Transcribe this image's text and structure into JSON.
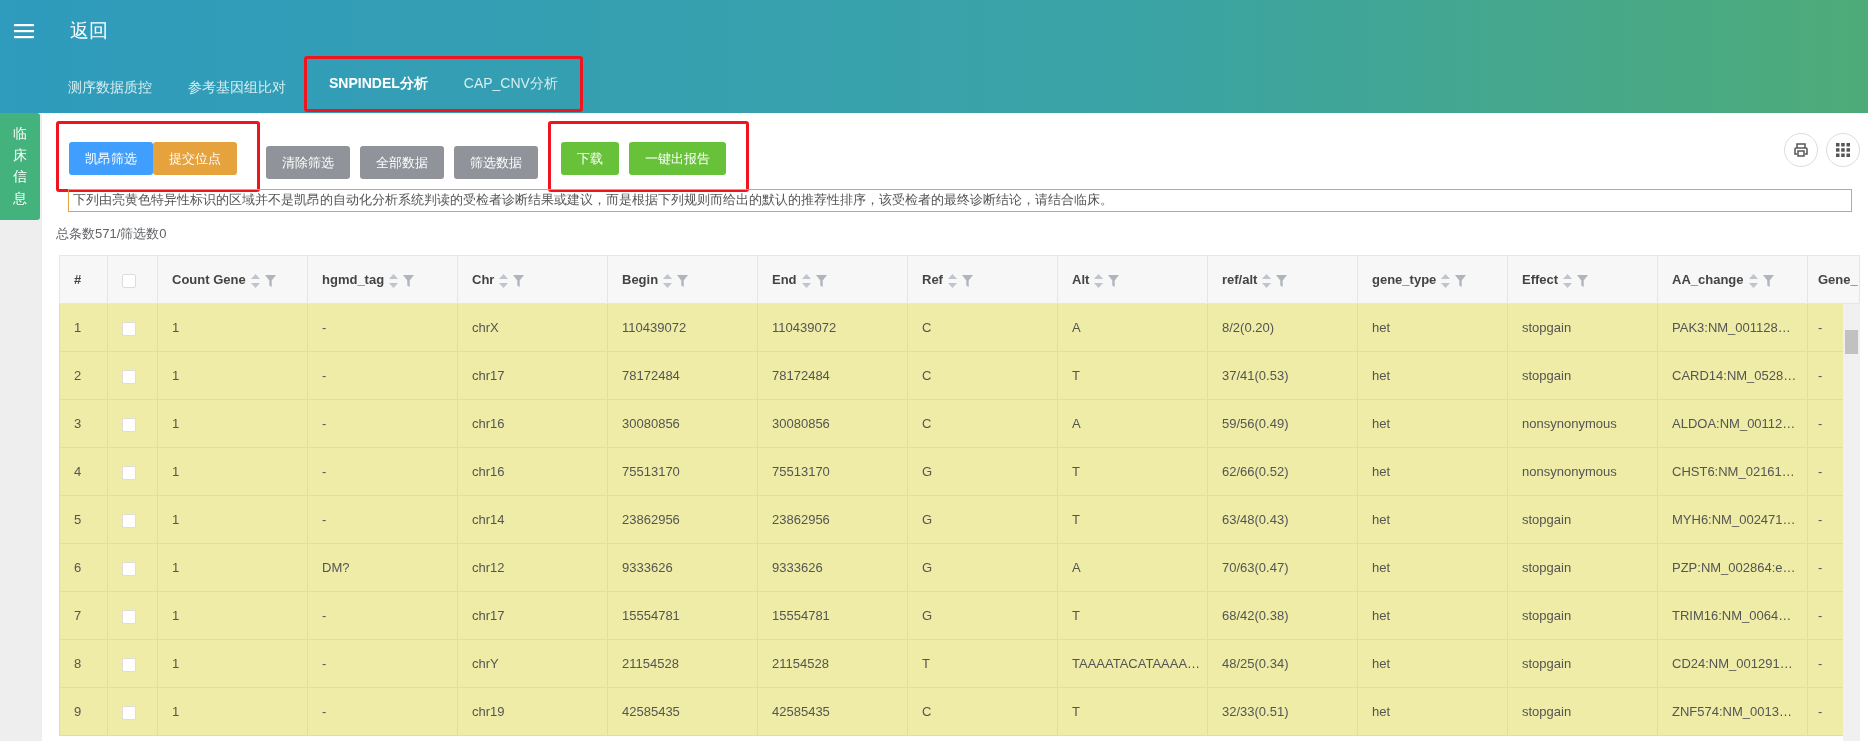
{
  "header": {
    "back": "返回"
  },
  "tabs": [
    {
      "label": "测序数据质控",
      "selected": false,
      "boxed": false
    },
    {
      "label": "参考基因组比对",
      "selected": false,
      "boxed": false
    },
    {
      "label": "SNPINDEL分析",
      "selected": true,
      "boxed": true
    },
    {
      "label": "CAP_CNV分析",
      "selected": false,
      "boxed": true
    }
  ],
  "side_tab": "临床信息",
  "buttons": [
    {
      "label": "凯昂筛选",
      "kind": "primary",
      "boxed": true
    },
    {
      "label": "提交位点",
      "kind": "warning",
      "boxed": true
    },
    {
      "label": "清除筛选",
      "kind": "info",
      "boxed": false
    },
    {
      "label": "全部数据",
      "kind": "info",
      "boxed": false
    },
    {
      "label": "筛选数据",
      "kind": "info",
      "boxed": false
    },
    {
      "label": "下载",
      "kind": "success",
      "boxed": true
    },
    {
      "label": "一键出报告",
      "kind": "success",
      "boxed": true
    }
  ],
  "notice": "下列由亮黄色特异性标识的区域并不是凯昂的自动化分析系统判读的受检者诊断结果或建议，而是根据下列规则而给出的默认的推荐性排序，该受检者的最终诊断结论，请结合临床。",
  "summary": "总条数571/筛选数0",
  "table": {
    "select_all_checked": false,
    "columns": [
      {
        "label": "#",
        "sortable": false
      },
      {
        "label": "Count Gene",
        "sortable": true
      },
      {
        "label": "hgmd_tag",
        "sortable": true
      },
      {
        "label": "Chr",
        "sortable": true
      },
      {
        "label": "Begin",
        "sortable": true
      },
      {
        "label": "End",
        "sortable": true
      },
      {
        "label": "Ref",
        "sortable": true
      },
      {
        "label": "Alt",
        "sortable": true
      },
      {
        "label": "ref/alt",
        "sortable": true
      },
      {
        "label": "gene_type",
        "sortable": true
      },
      {
        "label": "Effect",
        "sortable": true
      },
      {
        "label": "AA_change",
        "sortable": true
      },
      {
        "label": "Gene_",
        "sortable": false
      }
    ],
    "rows": [
      {
        "checked": false,
        "cells": [
          "1",
          "1",
          "-",
          "chrX",
          "110439072",
          "110439072",
          "C",
          "A",
          "8/2(0.20)",
          "het",
          "stopgain",
          "PAK3:NM_001128…",
          "-"
        ]
      },
      {
        "checked": false,
        "cells": [
          "2",
          "1",
          "-",
          "chr17",
          "78172484",
          "78172484",
          "C",
          "T",
          "37/41(0.53)",
          "het",
          "stopgain",
          "CARD14:NM_0528…",
          "-"
        ]
      },
      {
        "checked": false,
        "cells": [
          "3",
          "1",
          "-",
          "chr16",
          "30080856",
          "30080856",
          "C",
          "A",
          "59/56(0.49)",
          "het",
          "nonsynonymous",
          "ALDOA:NM_00112…",
          "-"
        ]
      },
      {
        "checked": false,
        "cells": [
          "4",
          "1",
          "-",
          "chr16",
          "75513170",
          "75513170",
          "G",
          "T",
          "62/66(0.52)",
          "het",
          "nonsynonymous",
          "CHST6:NM_02161…",
          "-"
        ]
      },
      {
        "checked": false,
        "cells": [
          "5",
          "1",
          "-",
          "chr14",
          "23862956",
          "23862956",
          "G",
          "T",
          "63/48(0.43)",
          "het",
          "stopgain",
          "MYH6:NM_002471…",
          "-"
        ]
      },
      {
        "checked": false,
        "cells": [
          "6",
          "1",
          "DM?",
          "chr12",
          "9333626",
          "9333626",
          "G",
          "A",
          "70/63(0.47)",
          "het",
          "stopgain",
          "PZP:NM_002864:e…",
          "-"
        ]
      },
      {
        "checked": false,
        "cells": [
          "7",
          "1",
          "-",
          "chr17",
          "15554781",
          "15554781",
          "G",
          "T",
          "68/42(0.38)",
          "het",
          "stopgain",
          "TRIM16:NM_0064…",
          "-"
        ]
      },
      {
        "checked": false,
        "cells": [
          "8",
          "1",
          "-",
          "chrY",
          "21154528",
          "21154528",
          "T",
          "TAAAATACATAAAA…",
          "48/25(0.34)",
          "het",
          "stopgain",
          "CD24:NM_001291…",
          "-"
        ]
      },
      {
        "checked": false,
        "cells": [
          "9",
          "1",
          "-",
          "chr19",
          "42585435",
          "42585435",
          "C",
          "T",
          "32/33(0.51)",
          "het",
          "stopgain",
          "ZNF574:NM_0013…",
          "-"
        ]
      }
    ]
  }
}
